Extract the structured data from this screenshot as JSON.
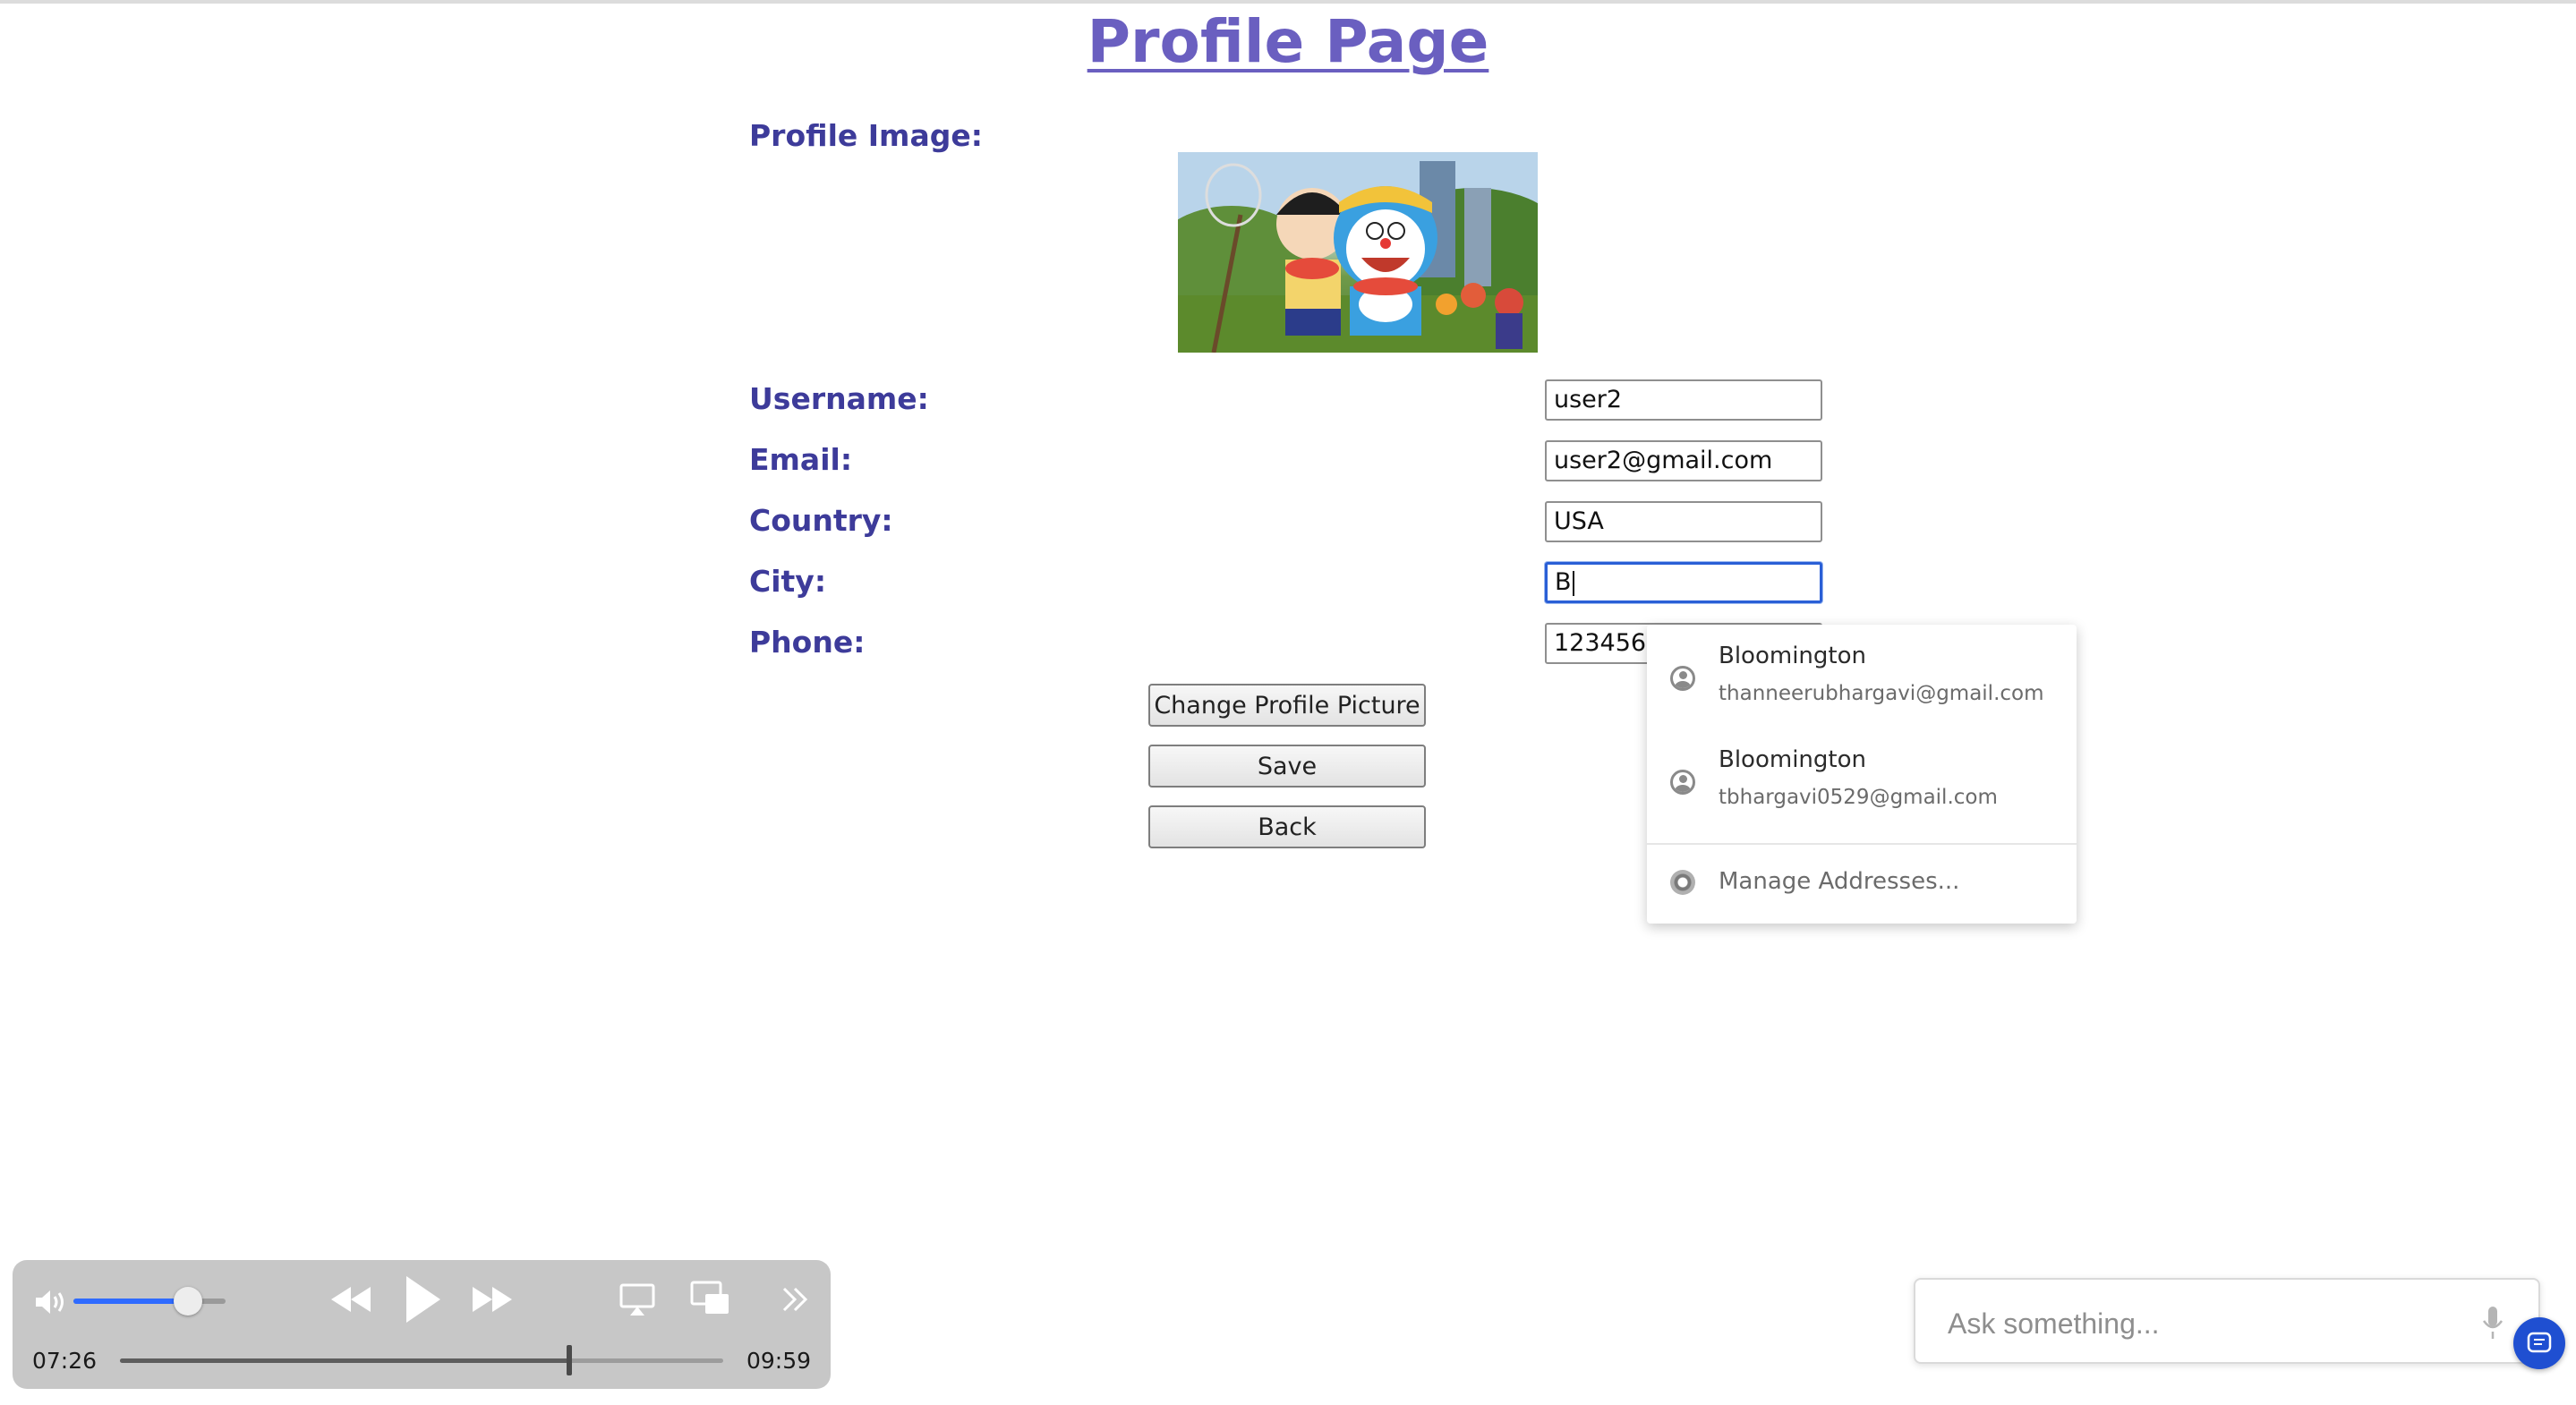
{
  "page": {
    "title": "Profile Page"
  },
  "form": {
    "profile_image_label": "Profile Image:",
    "fields": [
      {
        "label": "Username:",
        "value": "user2"
      },
      {
        "label": "Email:",
        "value": "user2@gmail.com"
      },
      {
        "label": "Country:",
        "value": "USA"
      },
      {
        "label": "City:",
        "value": "B"
      },
      {
        "label": "Phone:",
        "value": "1234567"
      }
    ],
    "buttons": {
      "change_picture": "Change Profile Picture",
      "save": "Save",
      "back": "Back"
    }
  },
  "autocomplete": {
    "suggestions": [
      {
        "main": "Bloomington",
        "sub": "thanneerubhargavi@gmail.com",
        "icon": "person-circle-icon"
      },
      {
        "main": "Bloomington",
        "sub": "tbhargavi0529@gmail.com",
        "icon": "person-circle-icon"
      }
    ],
    "manage": "Manage Addresses..."
  },
  "player": {
    "current_time": "07:26",
    "total_time": "09:59",
    "volume_fraction": 0.75,
    "progress_fraction": 0.745,
    "accent_color": "#2f6bff"
  },
  "assistant": {
    "placeholder": "Ask something..."
  }
}
